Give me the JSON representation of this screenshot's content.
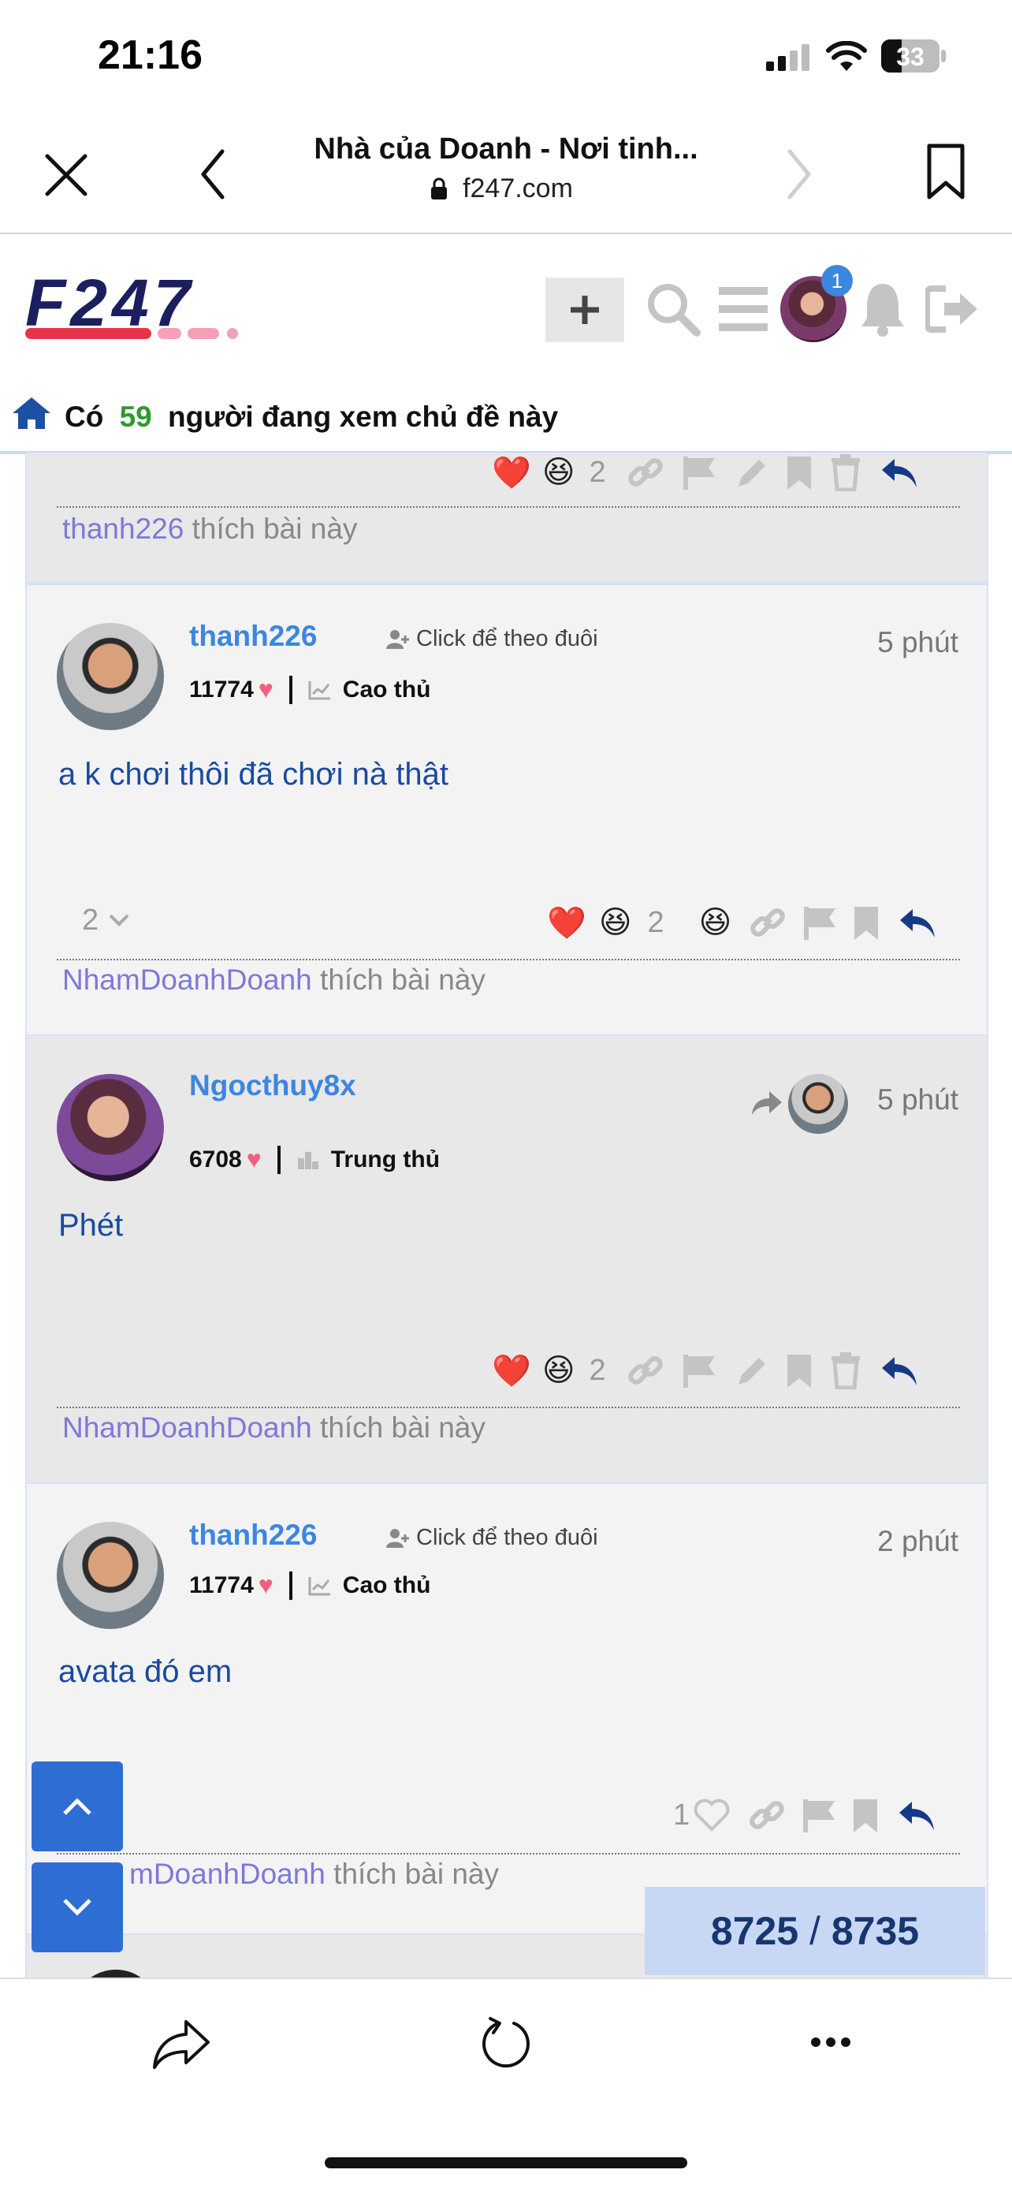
{
  "status_bar": {
    "time": "21:16",
    "battery": "33"
  },
  "browser": {
    "page_title": "Nhà của Doanh - Nơi tinh...",
    "url": "f247.com"
  },
  "site": {
    "logo_text": "F247",
    "notification_badge": "1",
    "viewers": {
      "prefix": "Có",
      "count": "59",
      "suffix": "người đang xem chủ đề này"
    }
  },
  "posts": [
    {
      "reactions_count": "2",
      "liked_by_user": "thanh226",
      "liked_by_suffix": " thích bài này"
    },
    {
      "username": "thanh226",
      "follow_label": "Click để theo đuôi",
      "time": "5 phút",
      "score": "11774",
      "rank": "Cao thủ",
      "content": "a k chơi thôi đã chơi nà thật",
      "replies_count": "2",
      "reactions_count": "2",
      "liked_by_user": "NhamDoanhDoanh",
      "liked_by_suffix": " thích bài này"
    },
    {
      "username": "Ngocthuy8x",
      "time": "5 phút",
      "score": "6708",
      "rank": "Trung thủ",
      "content": "Phét",
      "reactions_count": "2",
      "liked_by_user": "NhamDoanhDoanh",
      "liked_by_suffix": " thích bài này"
    },
    {
      "username": "thanh226",
      "follow_label": "Click để theo đuôi",
      "time": "2 phút",
      "score": "11774",
      "rank": "Cao thủ",
      "content": "avata đó em",
      "likes_count": "1",
      "liked_by_user": "mDoanhDoanh",
      "liked_by_suffix": " thích bài này"
    }
  ],
  "page_counter": {
    "current": "8725",
    "separator": " / ",
    "total": "8735"
  },
  "colors": {
    "accent": "#3d86e0",
    "brand": "#1b1f5e",
    "reply": "#173a87",
    "counter_bg": "#c8d8f4"
  }
}
